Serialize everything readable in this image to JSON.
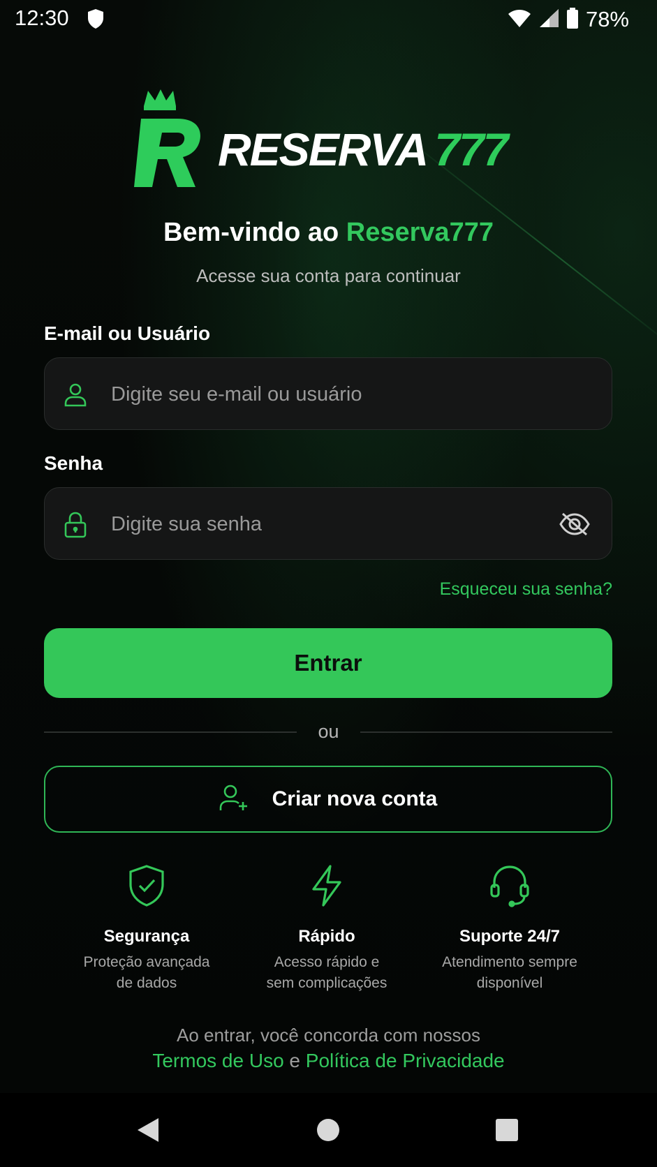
{
  "status_bar": {
    "time": "12:30",
    "battery": "78%",
    "icons": [
      "shield-icon",
      "wifi-icon",
      "signal-icon",
      "battery-icon"
    ]
  },
  "logo": {
    "word": "RESERVA",
    "number": "777",
    "mark": "R",
    "icon": "crown-icon"
  },
  "welcome": {
    "prefix": "Bem-vindo ao ",
    "brand": "Reserva777",
    "subtitle": "Acesse sua conta para continuar"
  },
  "form": {
    "email_label": "E-mail ou Usuário",
    "email_placeholder": "Digite seu e-mail ou usuário",
    "email_value": "",
    "password_label": "Senha",
    "password_placeholder": "Digite sua senha",
    "password_value": "",
    "forgot_link": "Esqueceu sua senha?",
    "submit_label": "Entrar",
    "divider_text": "ou",
    "create_account_label": "Criar nova conta"
  },
  "features": [
    {
      "icon": "shield-check-icon",
      "title": "Segurança",
      "desc_line1": "Proteção avançada",
      "desc_line2": "de dados"
    },
    {
      "icon": "lightning-icon",
      "title": "Rápido",
      "desc_line1": "Acesso rápido e",
      "desc_line2": "sem complicações"
    },
    {
      "icon": "headset-icon",
      "title": "Suporte 24/7",
      "desc_line1": "Atendimento sempre",
      "desc_line2": "disponível"
    }
  ],
  "terms": {
    "line1": "Ao entrar, você concorda com nossos",
    "terms_link": "Termos de Uso",
    "connector": " e ",
    "privacy_link": "Política de Privacidade"
  },
  "colors": {
    "accent": "#34c759",
    "background": "#050806",
    "input_bg": "#151616"
  }
}
